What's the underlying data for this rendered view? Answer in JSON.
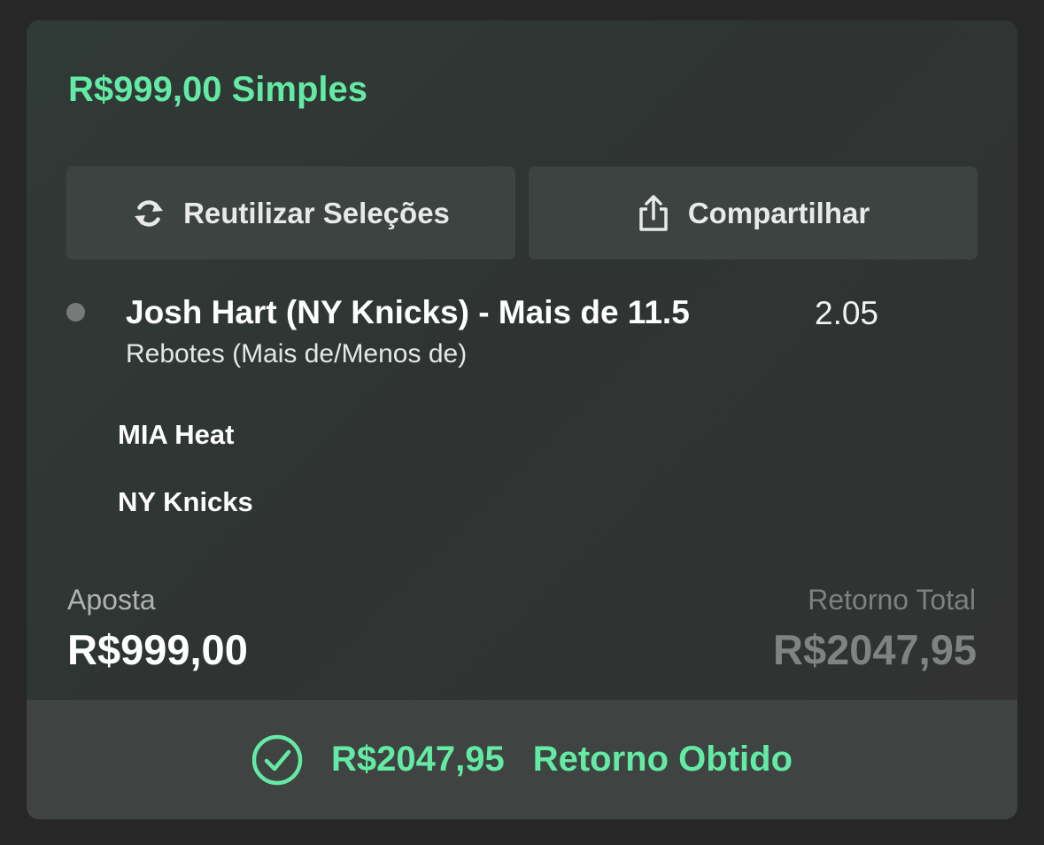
{
  "header": {
    "title": "R$999,00 Simples"
  },
  "actions": {
    "reuse_label": "Reutilizar Seleções",
    "reuse_icon": "refresh-icon",
    "share_label": "Compartilhar",
    "share_icon": "share-icon"
  },
  "selection": {
    "name": "Josh Hart (NY Knicks) - Mais de 11.5",
    "odds": "2.05",
    "market": "Rebotes (Mais de/Menos de)",
    "teams": [
      "MIA Heat",
      "NY Knicks"
    ]
  },
  "summary": {
    "stake_label": "Aposta",
    "stake_value": "R$999,00",
    "return_label": "Retorno Total",
    "return_value": "R$2047,95"
  },
  "footer": {
    "icon": "check-circle-icon",
    "amount": "R$2047,95",
    "label": "Retorno Obtido"
  },
  "colors": {
    "accent": "#63eaa4",
    "background": "#272727",
    "card": "#2f3432",
    "button": "#3d4341"
  }
}
